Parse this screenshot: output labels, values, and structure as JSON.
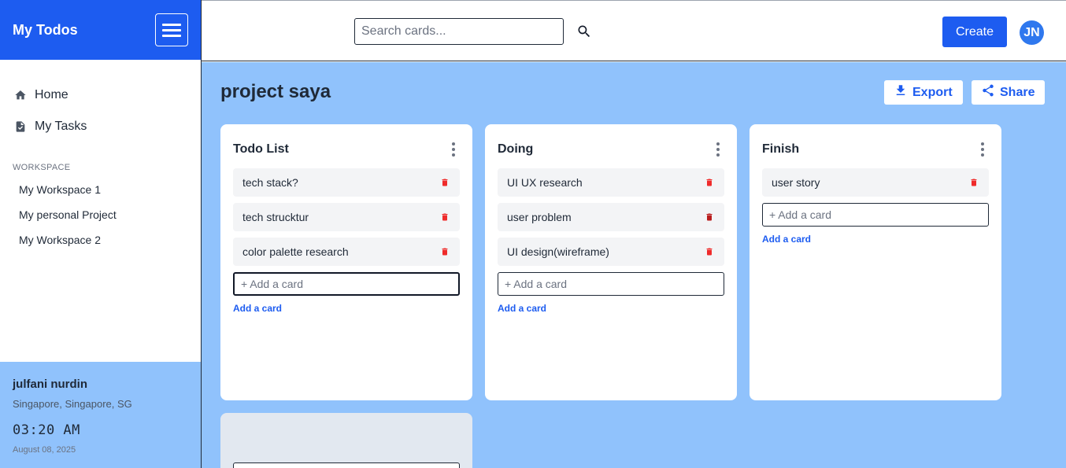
{
  "app": {
    "title": "My Todos"
  },
  "sidebar": {
    "nav": [
      {
        "label": "Home",
        "icon": "home-icon"
      },
      {
        "label": "My Tasks",
        "icon": "task-icon"
      }
    ],
    "workspace_label": "WORKSPACE",
    "workspaces": [
      "My Workspace 1",
      "My personal Project",
      "My Workspace 2"
    ],
    "user": {
      "name": "julfani nurdin",
      "location": "Singapore, Singapore, SG",
      "time": "03:20 AM",
      "date": "August 08, 2025"
    }
  },
  "topbar": {
    "search_placeholder": "Search cards...",
    "create_label": "Create",
    "avatar_initials": "JN"
  },
  "board": {
    "title": "project saya",
    "export_label": "Export",
    "share_label": "Share",
    "columns": [
      {
        "title": "Todo List",
        "cards": [
          "tech stack?",
          "tech strucktur",
          "color palette research"
        ],
        "add_placeholder": "+ Add a card",
        "add_link": "Add a card"
      },
      {
        "title": "Doing",
        "cards": [
          "UI UX research",
          "user problem",
          "UI design(wireframe)"
        ],
        "add_placeholder": "+ Add a card",
        "add_link": "Add a card"
      },
      {
        "title": "Finish",
        "cards": [
          "user story"
        ],
        "add_placeholder": "+ Add a card",
        "add_link": "Add a card"
      }
    ]
  },
  "colors": {
    "brand": "#1d5cf0",
    "board_bg": "#90c2fc",
    "delete": "#ef2b2b",
    "delete_hover": "#b91c1c"
  }
}
